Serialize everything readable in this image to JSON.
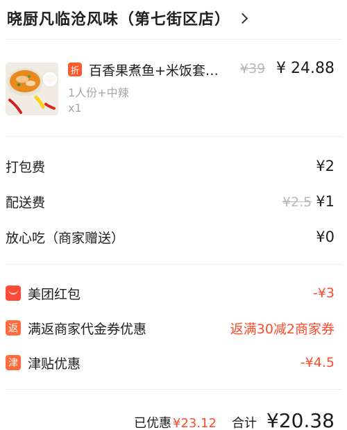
{
  "store": {
    "name": "晓厨凡临沧风味（第七街区店）"
  },
  "product": {
    "discount_tag": "折",
    "title": "百香果煮鱼+米饭套…",
    "original_price": "¥39",
    "price": "¥ 24.88",
    "spec": "1人份+中辣",
    "quantity": "x1"
  },
  "fees": {
    "packing": {
      "label": "打包费",
      "value": "¥2"
    },
    "delivery": {
      "label": "配送费",
      "original": "¥2.5",
      "value": "¥1"
    },
    "insurance": {
      "label": "放心吃（商家赠送）",
      "value": "¥0"
    }
  },
  "discounts": [
    {
      "icon_text": "",
      "icon": "red-envelope-icon",
      "label": "美团红包",
      "value": "-¥3"
    },
    {
      "icon_text": "返",
      "icon": "return-icon",
      "label": "满返商家代金券优惠",
      "value": "返满30减2商家券"
    },
    {
      "icon_text": "津",
      "icon": "subsidy-icon",
      "label": "津贴优惠",
      "value": "-¥4.5"
    }
  ],
  "summary": {
    "saved_label": "已优惠",
    "saved_value": "¥23.12",
    "total_label": "合计",
    "total_value": "¥20.38"
  },
  "colors": {
    "accent_red": "#ff4a2a",
    "tag_orange": "#ff5a2b",
    "muted": "#a7a7a7"
  }
}
